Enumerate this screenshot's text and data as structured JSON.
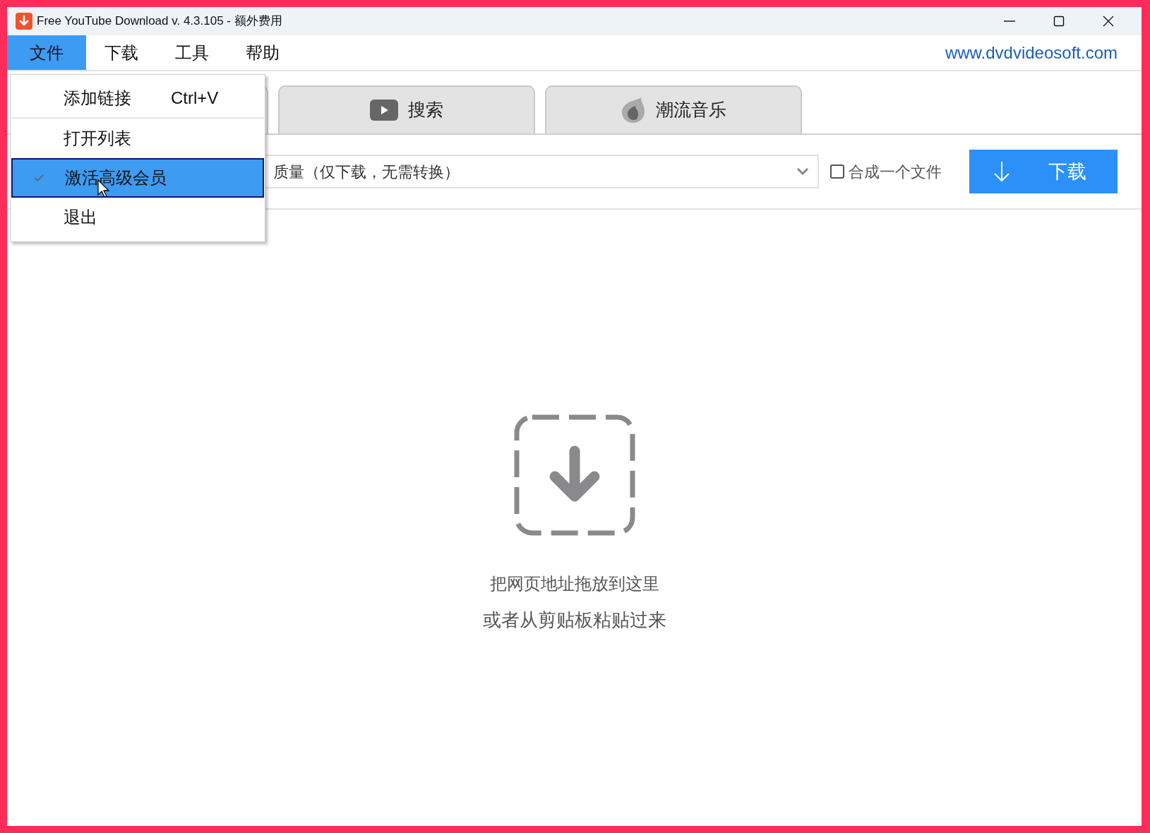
{
  "window": {
    "title": "Free YouTube Download v. 4.3.105 - 额外费用"
  },
  "menu_bar": [
    {
      "label": "文件",
      "selected": true
    },
    {
      "label": "下载",
      "selected": false
    },
    {
      "label": "工具",
      "selected": false
    },
    {
      "label": "帮助",
      "selected": false
    }
  ],
  "site_link": "www.dvdvideosoft.com",
  "tabs": [
    {
      "selected": true
    },
    {
      "label": "搜索",
      "kind": "play",
      "selected": false
    },
    {
      "label": "潮流音乐",
      "kind": "flame",
      "selected": false
    }
  ],
  "quality_dropdown": {
    "value": "质量（仅下载，无需转换）"
  },
  "merge_checkbox": {
    "label": "合成一个文件",
    "checked": false
  },
  "download_button": "下载",
  "drop_zone": {
    "line_1": "把网页地址拖放到这里",
    "line_2": "或者从剪贴板粘贴过来"
  },
  "file_menu": [
    {
      "label": "添加链接",
      "shortcut": "Ctrl+V",
      "checked": false,
      "selected": false,
      "separator_after": true
    },
    {
      "label": "打开列表",
      "checked": false,
      "selected": false,
      "separator_after": false
    },
    {
      "label": "激活高级会员",
      "checked": true,
      "selected": true,
      "separator_after": false
    },
    {
      "label": "退出",
      "checked": false,
      "selected": false,
      "separator_after": false
    }
  ]
}
